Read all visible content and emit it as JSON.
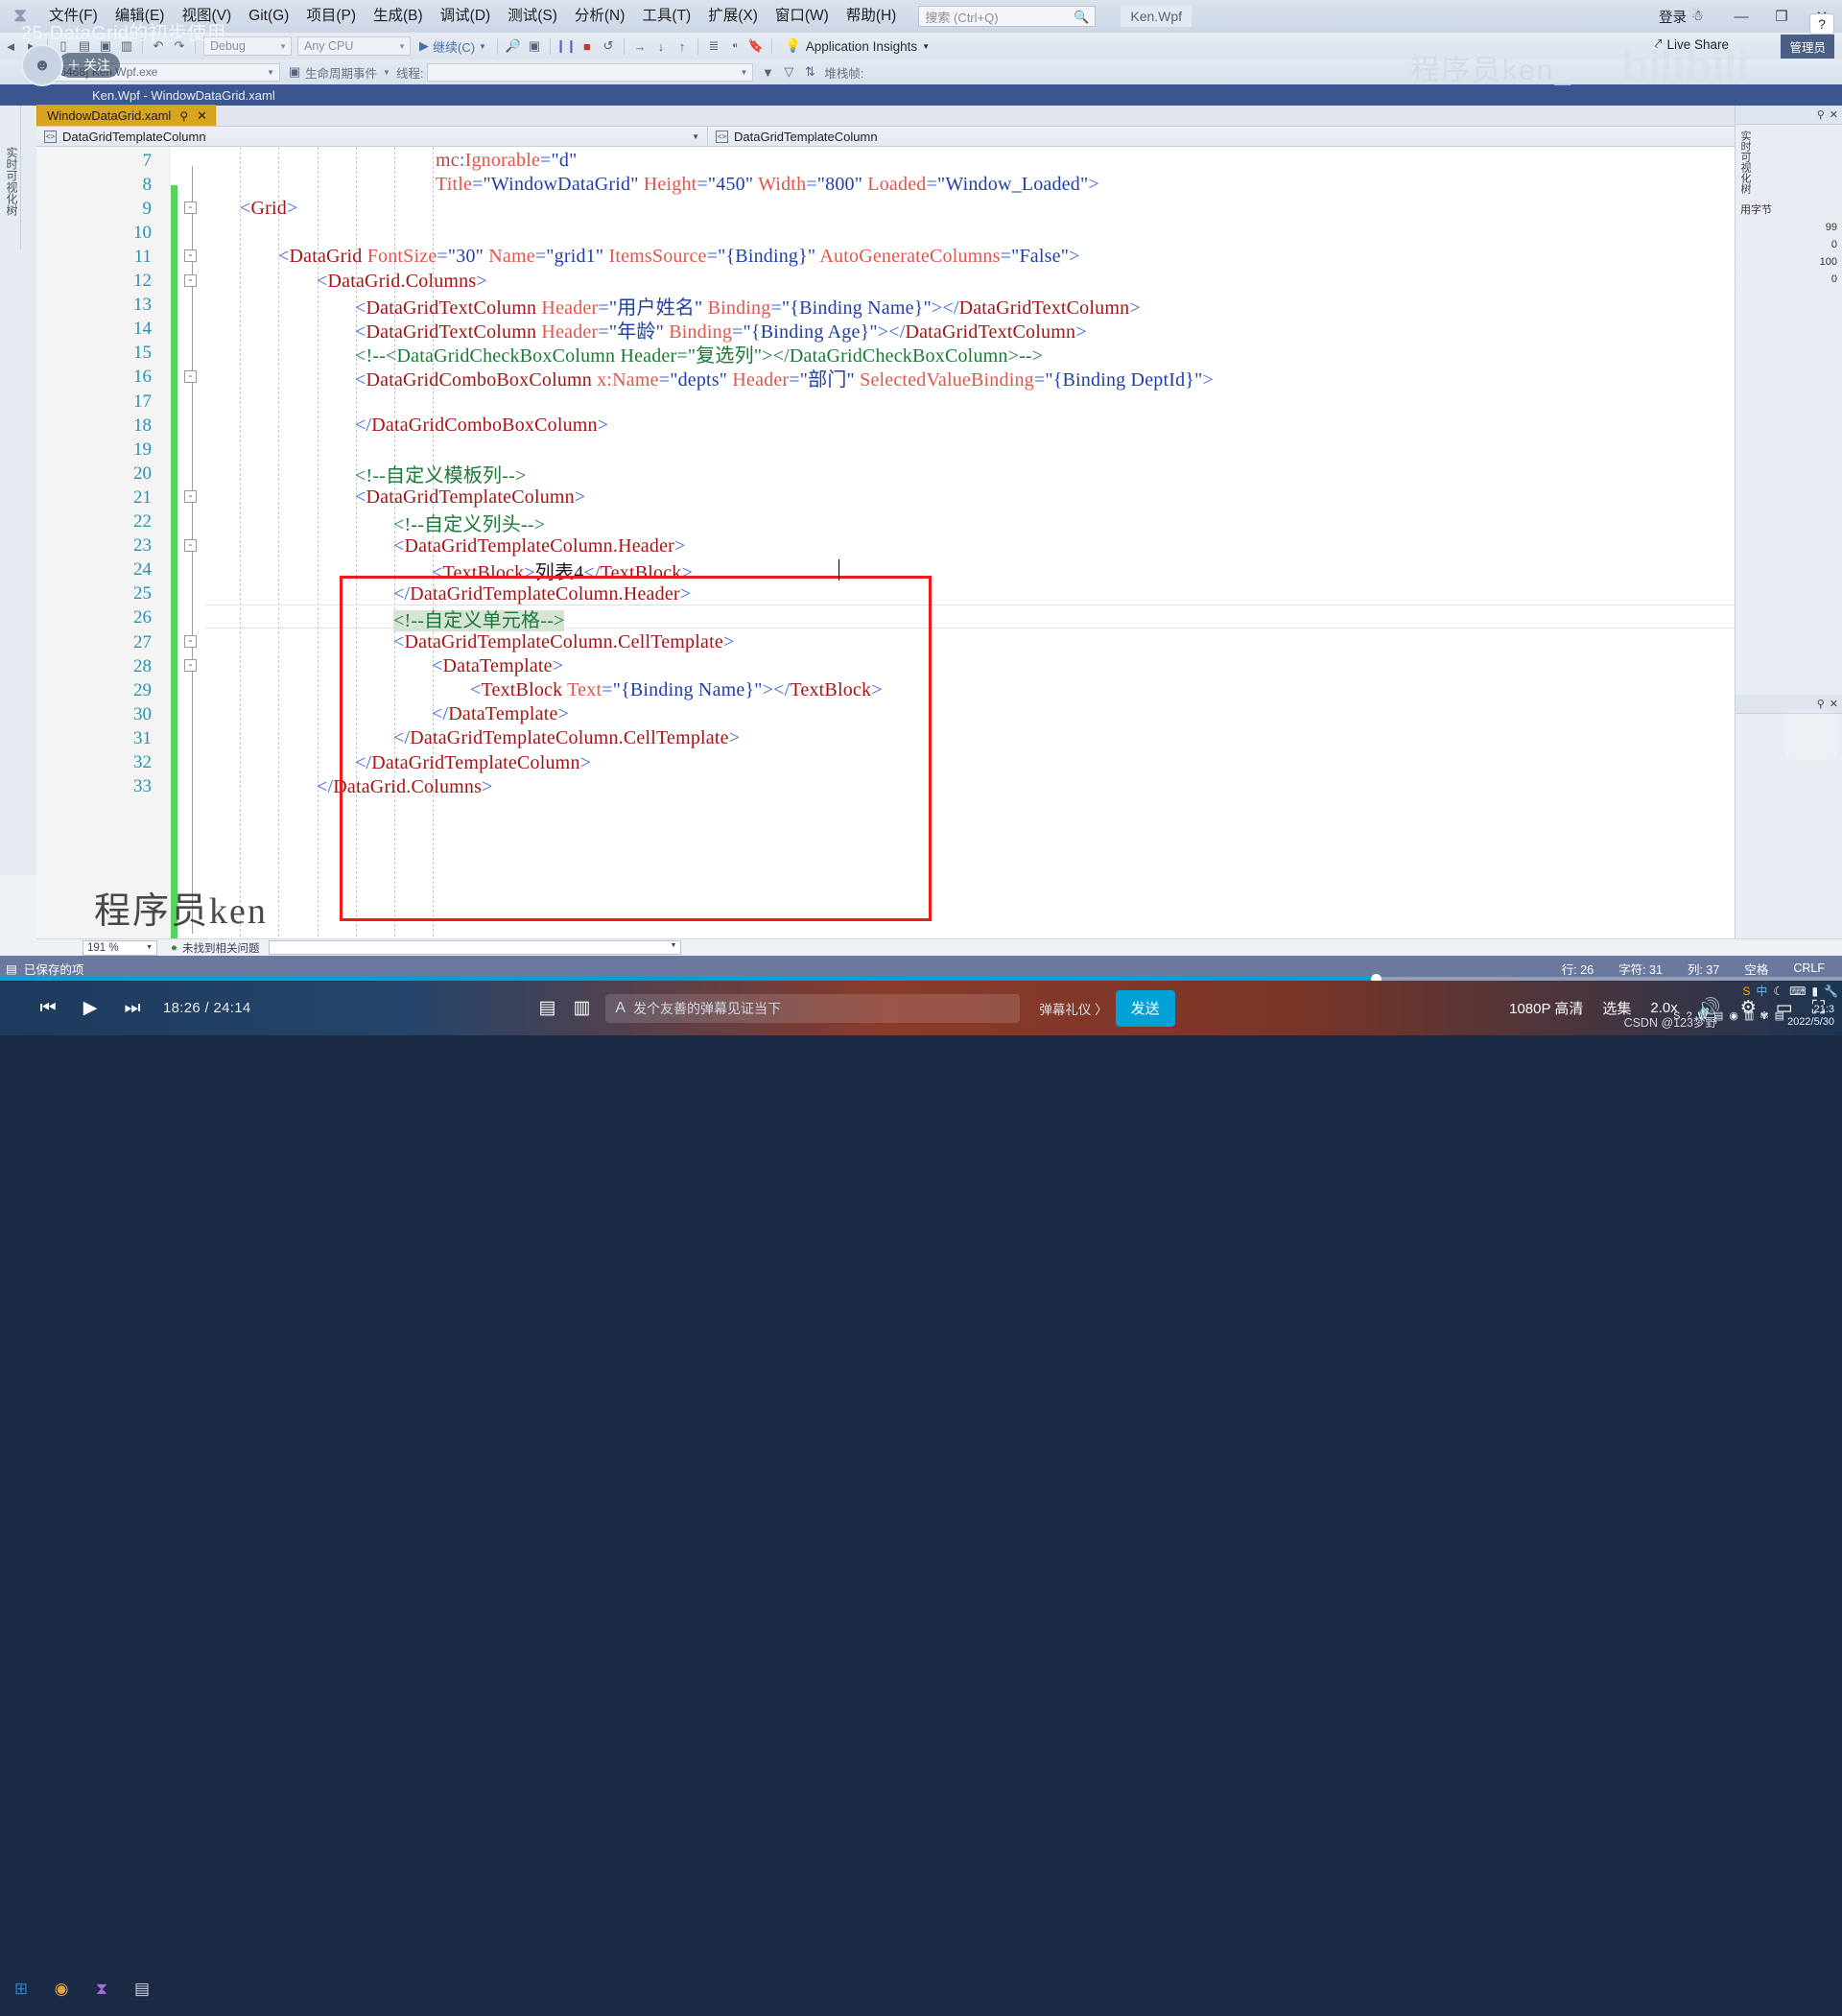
{
  "overlay": {
    "video_title": "25-DataGrid的初步使用",
    "follow_label": "关注",
    "avatar_icon": "user-avatar-icon",
    "help_icon": "?"
  },
  "vs": {
    "logo": "visual-studio-logo",
    "menu": [
      "文件(F)",
      "编辑(E)",
      "视图(V)",
      "Git(G)",
      "项目(P)",
      "生成(B)",
      "调试(D)",
      "测试(S)",
      "分析(N)",
      "工具(T)",
      "扩展(X)",
      "窗口(W)",
      "帮助(H)"
    ],
    "search_placeholder": "搜索 (Ctrl+Q)",
    "search_icon": "search-icon",
    "solution_name": "Ken.Wpf",
    "signin_label": "登录",
    "signin_icon": "account-icon",
    "window_buttons": [
      "—",
      "❐",
      "✕"
    ],
    "toolbar": {
      "config": "Debug",
      "platform": "Any CPU",
      "run_label": "继续(C)",
      "run_icon": "play-icon",
      "pause_icon": "pause-icon",
      "stop_icon": "stop-icon",
      "restart_icon": "restart-icon",
      "app_insights": "Application Insights",
      "live_share": "Live Share",
      "live_share_icon": "share-icon",
      "admin_label": "管理员"
    },
    "toolbar2": {
      "process": "[6468] Ken.Wpf.exe",
      "lifecycle": "生命周期事件",
      "thread": "线程:",
      "stack_frame": "堆栈帧:"
    },
    "doc_strip_title": "Ken.Wpf - WindowDataGrid.xaml",
    "tab": {
      "label": "WindowDataGrid.xaml",
      "pin_icon": "pin-icon",
      "close_icon": "close-icon"
    },
    "nav": {
      "left": "DataGridTemplateColumn",
      "right": "DataGridTemplateColumn",
      "icon": "code-element-icon"
    },
    "footer": {
      "zoom": "191 %",
      "error_text": "未找到相关问题",
      "error_icon": "shield-icon"
    },
    "status": {
      "saved_label": "已保存的项",
      "saved_icon": "document-icon",
      "line": "行: 26",
      "chars": "字符: 31",
      "col": "列: 37",
      "spaces": "空格",
      "eol": "CRLF"
    },
    "right_dock": {
      "labels": [
        "用字节",
        "99",
        "0",
        "100",
        "0"
      ],
      "vertical_text": "实时可视化树"
    },
    "left_dock_text": "实时可视化树"
  },
  "code": {
    "font_note": "serif monospace-ish",
    "lines": [
      {
        "n": "7",
        "fold": "",
        "indent": 0,
        "html": "<span class='t-mc'>mc</span><span class='t-ang'>:</span><span class='t-attr'>Ignorable</span><span class='t-ang'>=</span><span class='t-val'>\"d\"</span>",
        "pad": 240
      },
      {
        "n": "8",
        "fold": "",
        "indent": 0,
        "html": "<span class='t-attr'>Title</span><span class='t-ang'>=</span><span class='t-val'>\"WindowDataGrid\"</span> <span class='t-attr'>Height</span><span class='t-ang'>=</span><span class='t-val'>\"450\"</span> <span class='t-attr'>Width</span><span class='t-ang'>=</span><span class='t-val'>\"800\"</span> <span class='t-attr'>Loaded</span><span class='t-ang'>=</span><span class='t-val'>\"Window_Loaded\"</span><span class='t-ang'>&gt;</span>",
        "pad": 240
      },
      {
        "n": "9",
        "fold": "-",
        "indent": 0,
        "html": "<span class='t-ang'>&lt;</span><span class='t-tag'>Grid</span><span class='t-ang'>&gt;</span>",
        "pad": 36
      },
      {
        "n": "10",
        "fold": "",
        "indent": 0,
        "html": "",
        "pad": 36
      },
      {
        "n": "11",
        "fold": "-",
        "indent": 0,
        "html": "<span class='t-ang'>&lt;</span><span class='t-tag'>DataGrid</span> <span class='t-attr'>FontSize</span><span class='t-ang'>=</span><span class='t-val'>\"30\"</span> <span class='t-attr'>Name</span><span class='t-ang'>=</span><span class='t-val'>\"grid1\"</span> <span class='t-attr'>ItemsSource</span><span class='t-ang'>=</span><span class='t-val'>\"{Binding}\"</span> <span class='t-attr'>AutoGenerateColumns</span><span class='t-ang'>=</span><span class='t-val'>\"False\"</span><span class='t-ang'>&gt;</span>",
        "pad": 76
      },
      {
        "n": "12",
        "fold": "-",
        "indent": 0,
        "html": "<span class='t-ang'>&lt;</span><span class='t-tag'>DataGrid.Columns</span><span class='t-ang'>&gt;</span>",
        "pad": 116
      },
      {
        "n": "13",
        "fold": "",
        "indent": 0,
        "html": "<span class='t-ang'>&lt;</span><span class='t-tag'>DataGridTextColumn</span> <span class='t-attr'>Header</span><span class='t-ang'>=</span><span class='t-val'>\"用户姓名\"</span> <span class='t-attr'>Binding</span><span class='t-ang'>=</span><span class='t-val'>\"{Binding Name}\"</span><span class='t-ang'>&gt;&lt;/</span><span class='t-tag'>DataGridTextColumn</span><span class='t-ang'>&gt;</span>",
        "pad": 156
      },
      {
        "n": "14",
        "fold": "",
        "indent": 0,
        "html": "<span class='t-ang'>&lt;</span><span class='t-tag'>DataGridTextColumn</span> <span class='t-attr'>Header</span><span class='t-ang'>=</span><span class='t-val'>\"年龄\"</span> <span class='t-attr'>Binding</span><span class='t-ang'>=</span><span class='t-val'>\"{Binding Age}\"</span><span class='t-ang'>&gt;&lt;/</span><span class='t-tag'>DataGridTextColumn</span><span class='t-ang'>&gt;</span>",
        "pad": 156
      },
      {
        "n": "15",
        "fold": "",
        "indent": 0,
        "html": "<span class='t-cmt'>&lt;!--&lt;DataGridCheckBoxColumn Header=\"复选列\"&gt;&lt;/DataGridCheckBoxColumn&gt;--&gt;</span>",
        "pad": 156
      },
      {
        "n": "16",
        "fold": "-",
        "indent": 0,
        "html": "<span class='t-ang'>&lt;</span><span class='t-tag'>DataGridComboBoxColumn</span> <span class='t-attr'>x:Name</span><span class='t-ang'>=</span><span class='t-val'>\"depts\"</span> <span class='t-attr'>Header</span><span class='t-ang'>=</span><span class='t-val'>\"部门\"</span> <span class='t-attr'>SelectedValueBinding</span><span class='t-ang'>=</span><span class='t-val'>\"{Binding DeptId}\"</span><span class='t-ang'>&gt;</span>",
        "pad": 156
      },
      {
        "n": "17",
        "fold": "",
        "indent": 0,
        "html": "",
        "pad": 156
      },
      {
        "n": "18",
        "fold": "",
        "indent": 0,
        "html": "<span class='t-ang'>&lt;/</span><span class='t-tag'>DataGridComboBoxColumn</span><span class='t-ang'>&gt;</span>",
        "pad": 156
      },
      {
        "n": "19",
        "fold": "",
        "indent": 0,
        "html": "",
        "pad": 156
      },
      {
        "n": "20",
        "fold": "",
        "indent": 0,
        "html": "<span class='t-cmt'>&lt;!--自定义模板列--&gt;</span>",
        "pad": 156
      },
      {
        "n": "21",
        "fold": "-",
        "indent": 0,
        "html": "<span class='t-ang'>&lt;</span><span class='t-tag'>DataGridTemplateColumn</span><span class='t-ang'>&gt;</span>",
        "pad": 156
      },
      {
        "n": "22",
        "fold": "",
        "indent": 0,
        "html": "<span class='t-cmt'>&lt;!--自定义列头--&gt;</span>",
        "pad": 196
      },
      {
        "n": "23",
        "fold": "-",
        "indent": 0,
        "html": "<span class='t-ang'>&lt;</span><span class='t-tag'>DataGridTemplateColumn.Header</span><span class='t-ang'>&gt;</span>",
        "pad": 196
      },
      {
        "n": "24",
        "fold": "",
        "indent": 0,
        "html": "<span class='t-ang'>&lt;</span><span class='t-tag'>TextBlock</span><span class='t-ang'>&gt;</span><span class='t-txt'>列表4</span><span class='t-ang'>&lt;/</span><span class='t-tag'>TextBlock</span><span class='t-ang'>&gt;</span>",
        "pad": 236
      },
      {
        "n": "25",
        "fold": "",
        "indent": 0,
        "html": "<span class='t-ang'>&lt;/</span><span class='t-tag'>DataGridTemplateColumn.Header</span><span class='t-ang'>&gt;</span>",
        "pad": 196
      },
      {
        "n": "26",
        "fold": "",
        "indent": 0,
        "html": "<span class='t-cmt sel-hl'>&lt;!--自定义单元格--&gt;</span>",
        "pad": 196,
        "current": true
      },
      {
        "n": "27",
        "fold": "-",
        "indent": 0,
        "html": "<span class='t-ang'>&lt;</span><span class='t-tag'>DataGridTemplateColumn.CellTemplate</span><span class='t-ang'>&gt;</span>",
        "pad": 196
      },
      {
        "n": "28",
        "fold": "-",
        "indent": 0,
        "html": "<span class='t-ang'>&lt;</span><span class='t-tag'>DataTemplate</span><span class='t-ang'>&gt;</span>",
        "pad": 236
      },
      {
        "n": "29",
        "fold": "",
        "indent": 0,
        "html": "<span class='t-ang'>&lt;</span><span class='t-tag'>TextBlock</span> <span class='t-attr'>Text</span><span class='t-ang'>=</span><span class='t-val'>\"{Binding Name}\"</span><span class='t-ang'>&gt;&lt;/</span><span class='t-tag'>TextBlock</span><span class='t-ang'>&gt;</span>",
        "pad": 276
      },
      {
        "n": "30",
        "fold": "",
        "indent": 0,
        "html": "<span class='t-ang'>&lt;/</span><span class='t-tag'>DataTemplate</span><span class='t-ang'>&gt;</span>",
        "pad": 236
      },
      {
        "n": "31",
        "fold": "",
        "indent": 0,
        "html": "<span class='t-ang'>&lt;/</span><span class='t-tag'>DataGridTemplateColumn.CellTemplate</span><span class='t-ang'>&gt;</span>",
        "pad": 196
      },
      {
        "n": "32",
        "fold": "",
        "indent": 0,
        "html": "<span class='t-ang'>&lt;/</span><span class='t-tag'>DataGridTemplateColumn</span><span class='t-ang'>&gt;</span>",
        "pad": 156
      },
      {
        "n": "33",
        "fold": "",
        "indent": 0,
        "html": "<span class='t-ang'>&lt;/</span><span class='t-tag'>DataGrid.Columns</span><span class='t-ang'>&gt;</span>",
        "pad": 116
      }
    ]
  },
  "watermarks": {
    "editor": "程序员ken",
    "title": "程序员ken_",
    "bilibili": "bilibili",
    "csdn": "CSDN @123梦野"
  },
  "player": {
    "prev_icon": "previous-icon",
    "play_icon": "play-icon",
    "next_icon": "next-icon",
    "timecode": "18:26 / 24:14",
    "danmu_placeholder": "发个友善的弹幕见证当下",
    "danmu_icon": "font-icon",
    "etiquette": "弹幕礼仪 〉",
    "send_label": "发送",
    "quality": "1080P 高清",
    "episodes": "选集",
    "speed": "2.0x",
    "volume_icon": "volume-icon",
    "settings_icon": "gear-icon",
    "widescreen_icon": "widescreen-icon",
    "fullscreen_icon": "fullscreen-icon",
    "danmu_toggle_icon": "danmaku-icon",
    "danmu_settings_icon": "danmaku-settings-icon"
  },
  "taskbar": {
    "start_icon": "windows-start-icon",
    "icons": [
      "chrome-icon",
      "visual-studio-icon",
      "calculator-icon"
    ],
    "clock_time": "21:3",
    "clock_date": "2022/5/30"
  }
}
